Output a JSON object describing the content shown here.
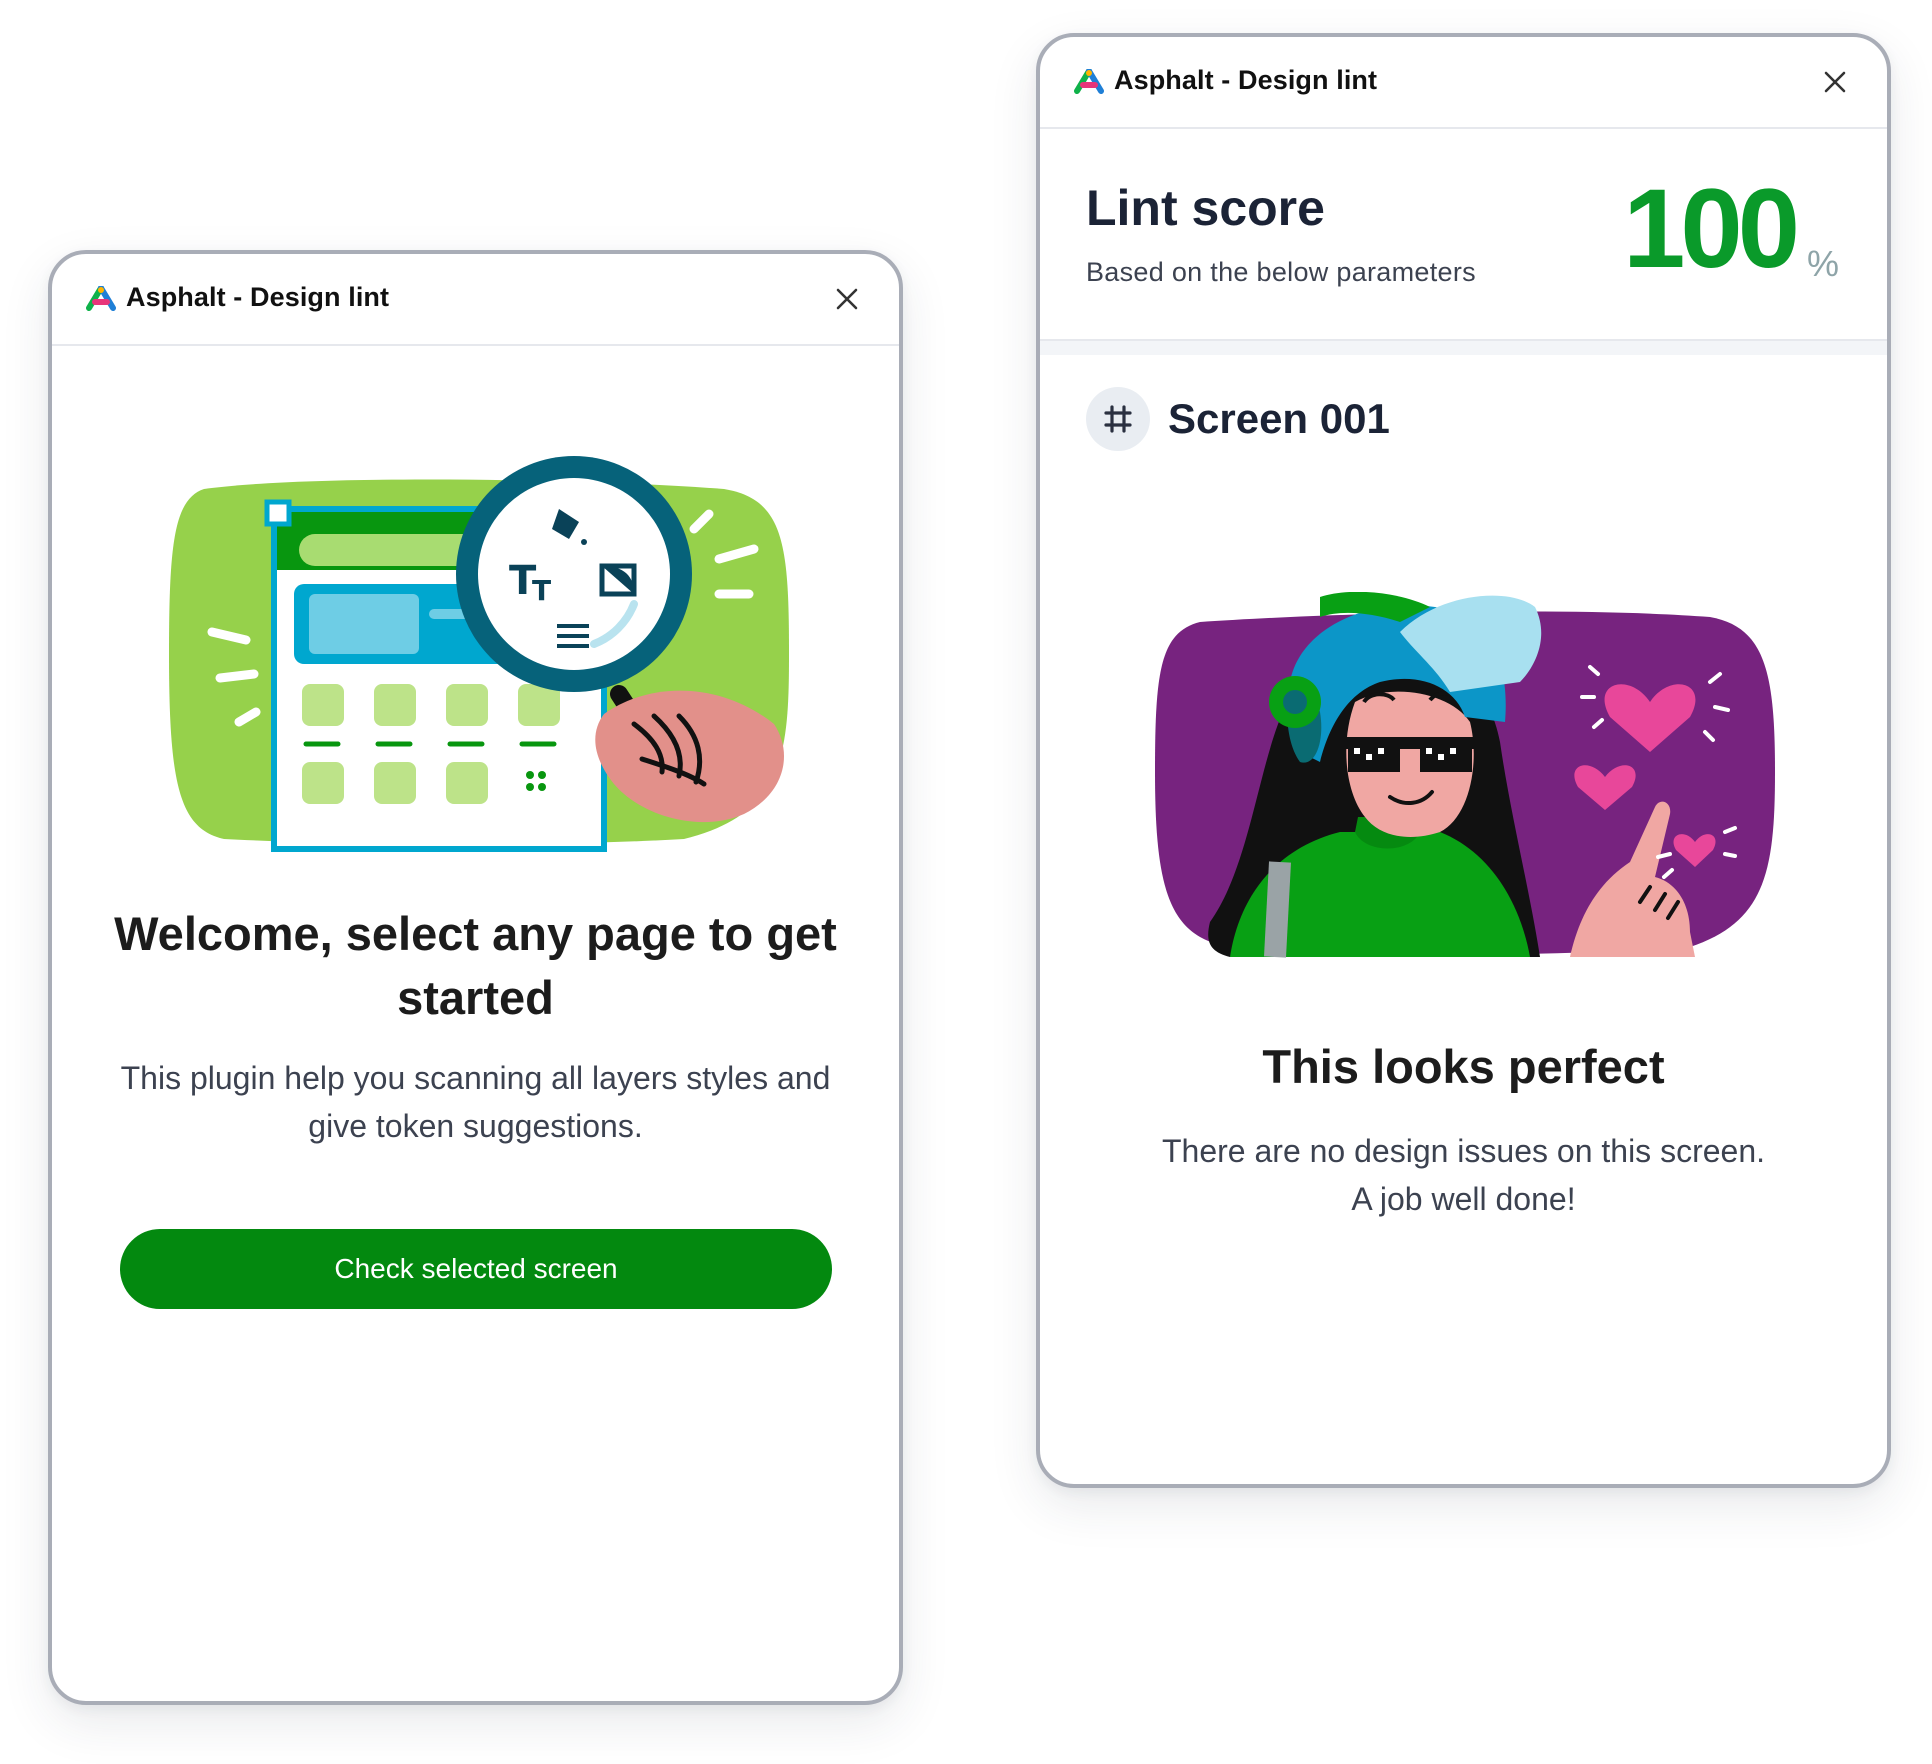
{
  "welcome_panel": {
    "window_title": "Asphalt - Design lint",
    "icons": {
      "logo": "asphalt-logo-icon",
      "close": "close-icon",
      "illustration": "magnifier-screen-illustration"
    },
    "heading": "Welcome, select any page to get started",
    "description": "This plugin help you scanning all layers styles and give token suggestions.",
    "primary_button": "Check selected screen"
  },
  "result_panel": {
    "window_title": "Asphalt - Design lint",
    "icons": {
      "logo": "asphalt-logo-icon",
      "close": "close-icon",
      "frame": "frame-hash-icon",
      "illustration": "rider-celebration-illustration"
    },
    "score": {
      "label": "Lint score",
      "sublabel": "Based on the below parameters",
      "value": "100",
      "unit": "%"
    },
    "screen_name": "Screen 001",
    "heading": "This looks perfect",
    "message_line1": "There are no design issues on this screen.",
    "message_line2": "A job well done!"
  },
  "colors": {
    "primary_green": "#03890f",
    "score_green": "#0a9a2a",
    "panel_border": "#a9adb7",
    "illustration_green": "#96d14b",
    "illustration_purple": "#77237f"
  }
}
